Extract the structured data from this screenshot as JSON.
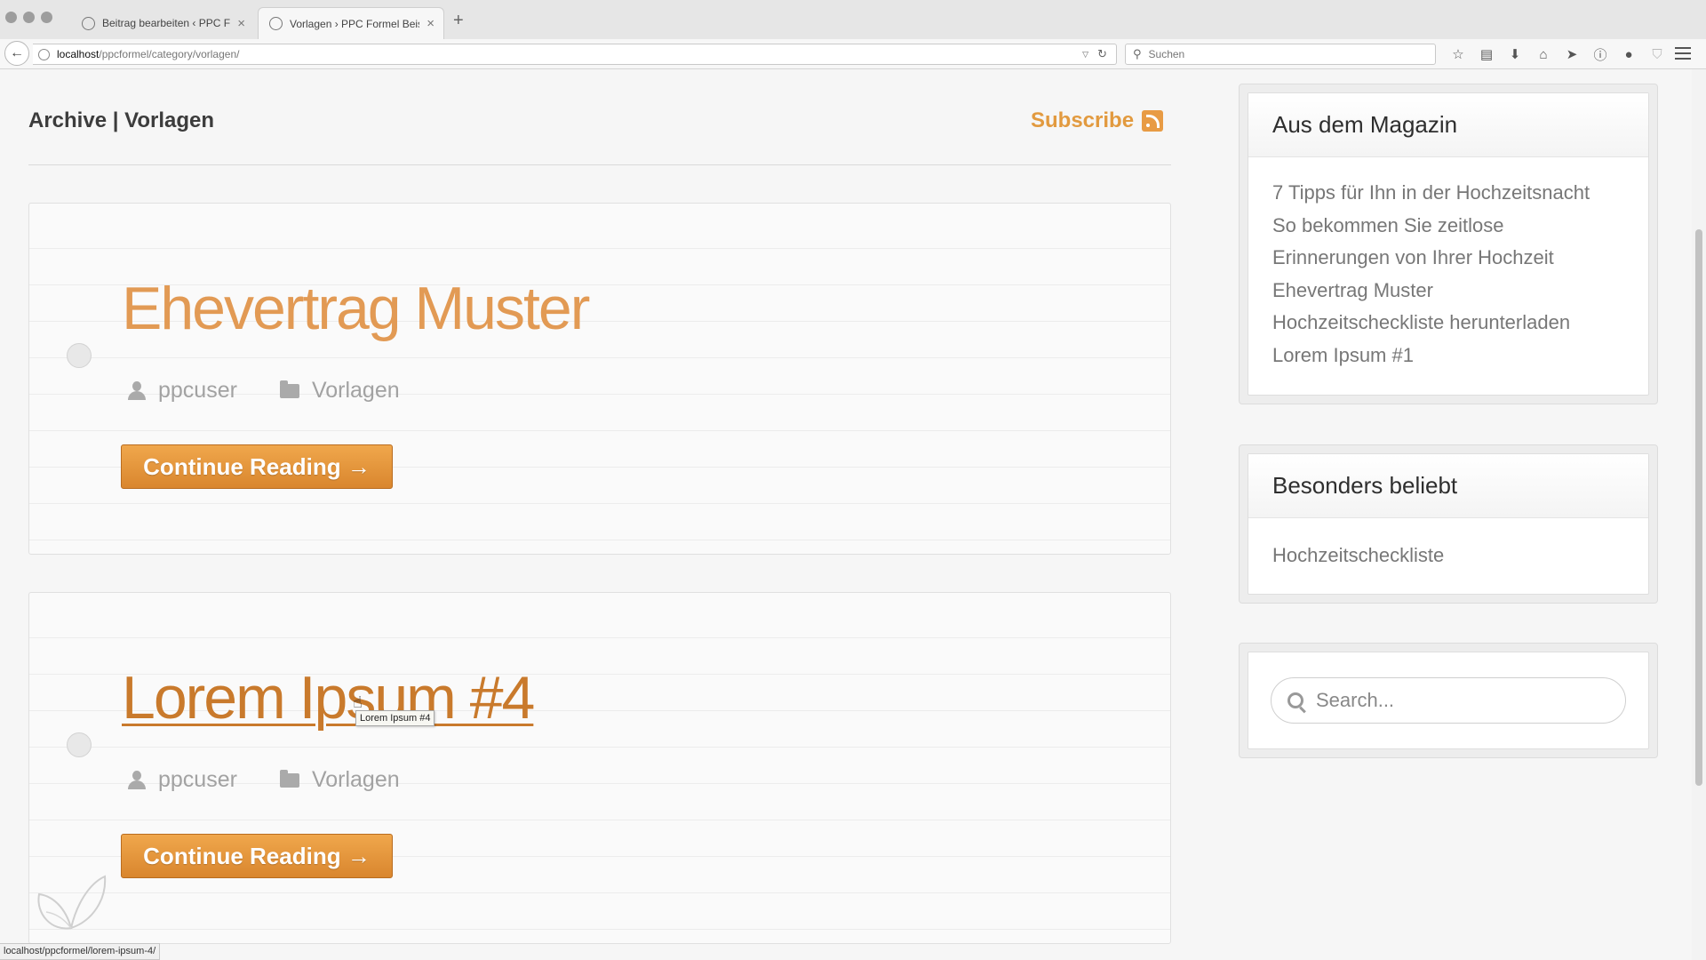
{
  "browser": {
    "tabs": [
      {
        "label": "Beitrag bearbeiten ‹ PPC Fo...",
        "active": false
      },
      {
        "label": "Vorlagen › PPC Formel Beis...",
        "active": true
      }
    ],
    "url_host": "localhost",
    "url_path": "/ppcformel/category/vorlagen/",
    "search_placeholder": "Suchen",
    "status_url": "localhost/ppcformel/lorem-ipsum-4/"
  },
  "page": {
    "archive_title": "Archive | Vorlagen",
    "subscribe_label": "Subscribe",
    "accent_color": "#e29a54"
  },
  "posts": [
    {
      "title": "Ehevertrag Muster",
      "author": "ppcuser",
      "category": "Vorlagen",
      "button": "Continue Reading →"
    },
    {
      "title": "Lorem Ipsum #4",
      "author": "ppcuser",
      "category": "Vorlagen",
      "button": "Continue Reading →",
      "tooltip": "Lorem Ipsum #4"
    }
  ],
  "sidebar": {
    "magazin": {
      "title": "Aus dem Magazin",
      "links": [
        "7 Tipps für Ihn in der Hochzeitsnacht",
        "So bekommen Sie zeitlose",
        "Erinnerungen von Ihrer Hochzeit",
        "Ehevertrag Muster",
        "Hochzeitscheckliste herunterladen",
        "Lorem Ipsum #1"
      ]
    },
    "beliebt": {
      "title": "Besonders beliebt",
      "links": [
        "Hochzeitscheckliste"
      ]
    },
    "search": {
      "placeholder": "Search..."
    }
  }
}
